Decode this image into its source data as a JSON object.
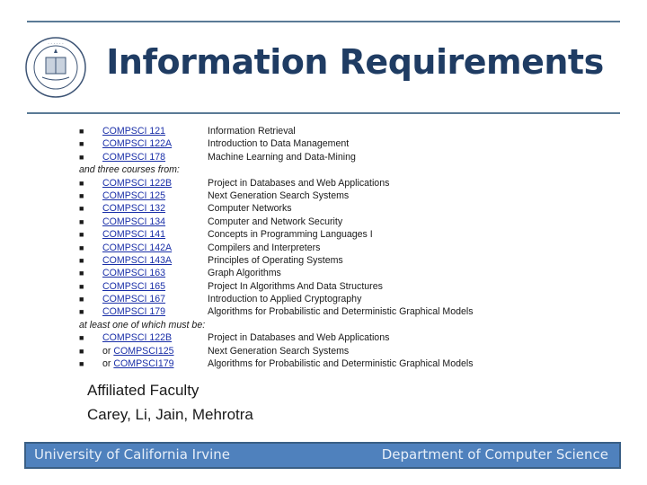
{
  "slide": {
    "title": "Information Requirements",
    "logo": "uc-seal-icon"
  },
  "required_courses": [
    {
      "code": "COMPSCI 121",
      "description": "Information Retrieval"
    },
    {
      "code": "COMPSCI 122A",
      "description": "Introduction to Data Management"
    },
    {
      "code": "COMPSCI 178",
      "description": "Machine Learning and Data-Mining"
    }
  ],
  "elective_intro": "and three courses from:",
  "elective_courses": [
    {
      "code": "COMPSCI 122B",
      "description": "Project in Databases and Web Applications"
    },
    {
      "code": "COMPSCI 125",
      "description": "Next Generation Search Systems"
    },
    {
      "code": "COMPSCI 132",
      "description": "Computer Networks"
    },
    {
      "code": "COMPSCI 134",
      "description": "Computer and Network Security"
    },
    {
      "code": "COMPSCI 141",
      "description": "Concepts in Programming Languages I"
    },
    {
      "code": "COMPSCI 142A",
      "description": "Compilers and Interpreters"
    },
    {
      "code": "COMPSCI 143A",
      "description": "Principles of Operating Systems"
    },
    {
      "code": "COMPSCI 163",
      "description": "Graph Algorithms"
    },
    {
      "code": "COMPSCI 165",
      "description": "Project In Algorithms And Data Structures"
    },
    {
      "code": "COMPSCI 167",
      "description": "Introduction to Applied Cryptography"
    },
    {
      "code": "COMPSCI 179",
      "description": "Algorithms for Probabilistic and Deterministic Graphical Models"
    }
  ],
  "must_intro": "at least one of which must be:",
  "must_courses": [
    {
      "prefix": "",
      "code": "COMPSCI 122B",
      "description": "Project in Databases and Web Applications"
    },
    {
      "prefix": "or ",
      "code": "COMPSCI125",
      "description": "Next Generation Search Systems"
    },
    {
      "prefix": "or ",
      "code": "COMPSCI179",
      "description": "Algorithms for Probabilistic and Deterministic Graphical Models"
    }
  ],
  "faculty": {
    "heading": "Affiliated Faculty",
    "names": "Carey, Li, Jain, Mehrotra"
  },
  "footer": {
    "left": "University of California Irvine",
    "right": "Department of Computer Science"
  },
  "colors": {
    "title": "#1f3c63",
    "rule": "#5a7a96",
    "link": "#1a2fa8",
    "footer_bg": "#4f81bd",
    "footer_border": "#3a5f85"
  }
}
